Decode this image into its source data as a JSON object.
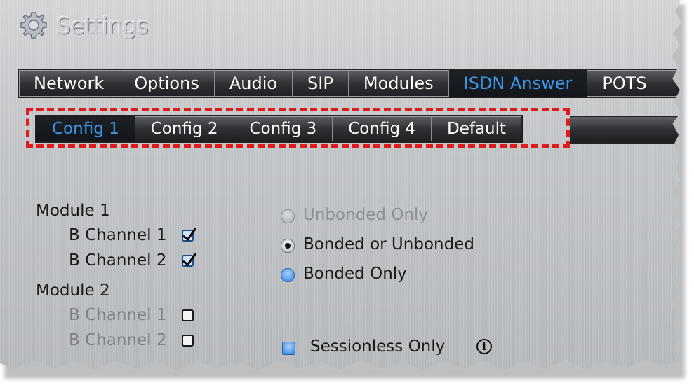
{
  "app": {
    "title": "Settings"
  },
  "main_tabs": [
    {
      "label": "Network",
      "active": false
    },
    {
      "label": "Options",
      "active": false
    },
    {
      "label": "Audio",
      "active": false
    },
    {
      "label": "SIP",
      "active": false
    },
    {
      "label": "Modules",
      "active": false
    },
    {
      "label": "ISDN Answer",
      "active": true
    },
    {
      "label": "POTS",
      "active": false
    }
  ],
  "config_tabs": [
    {
      "label": "Config 1",
      "active": true
    },
    {
      "label": "Config 2",
      "active": false
    },
    {
      "label": "Config 3",
      "active": false
    },
    {
      "label": "Config 4",
      "active": false
    },
    {
      "label": "Default",
      "active": false
    }
  ],
  "modules": {
    "module1": {
      "label": "Module 1",
      "ch1": {
        "label": "B Channel 1",
        "checked": true
      },
      "ch2": {
        "label": "B Channel 2",
        "checked": true
      }
    },
    "module2": {
      "label": "Module 2",
      "ch1": {
        "label": "B Channel 1",
        "checked": false
      },
      "ch2": {
        "label": "B Channel 2",
        "checked": false
      }
    }
  },
  "bonding": {
    "unbonded_only": "Unbonded Only",
    "bonded_or_unbonded": "Bonded or Unbonded",
    "bonded_only": "Bonded Only",
    "selected": "bonded_or_unbonded"
  },
  "sessionless": {
    "label": "Sessionless Only",
    "checked": false
  },
  "colors": {
    "active_tab": "#3d95ea",
    "highlight": "#e01b1b",
    "disabled_text": "#7d8187"
  },
  "icons": {
    "title_icon": "gear-icon",
    "info": "info-icon"
  }
}
